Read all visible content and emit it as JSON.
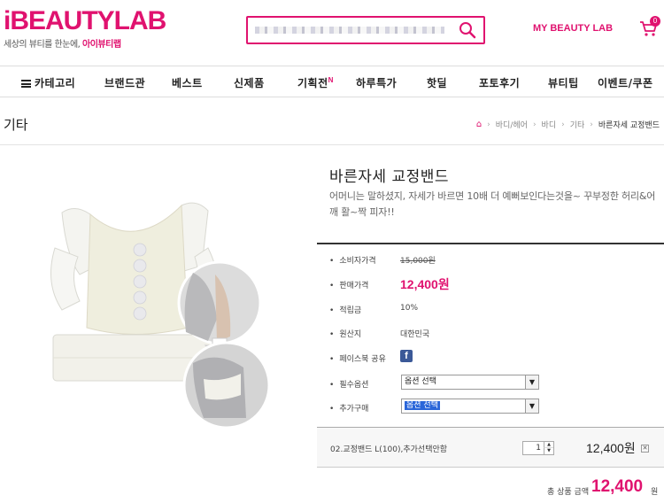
{
  "header": {
    "logo": "iBEAUTYLAB",
    "tagline_prefix": "세상의 뷰티를 한눈에,",
    "tagline_brand": "아이뷰티랩",
    "search_placeholder": "",
    "my_beauty_lab": "MY BEAUTY LAB",
    "cart_count": "0"
  },
  "nav": {
    "category": "카테고리",
    "items": [
      "브랜드관",
      "베스트",
      "신제품",
      "기획전",
      "하루특가",
      "핫딜",
      "포토후기",
      "뷰티팁",
      "이벤트/쿠폰"
    ],
    "new_badge": "N"
  },
  "page": {
    "title": "기타",
    "breadcrumb": [
      "바디/헤어",
      "바디",
      "기타",
      "바른자세 교정밴드"
    ]
  },
  "product": {
    "name": "바른자세 교정밴드",
    "description": "어머니는 말하셨지, 자세가 바르면 10배 더 예뻐보인다는것을~ 꾸부정한 허리&어깨 활~짝 피자!!",
    "rows": {
      "consumer_price_label": "소비자가격",
      "consumer_price": "15,000원",
      "sale_price_label": "판매가격",
      "sale_price": "12,400원",
      "points_label": "적립금",
      "points": "10%",
      "origin_label": "원산지",
      "origin": "대한민국",
      "facebook_label": "페이스북 공유",
      "required_label": "필수옵션",
      "required_value": "옵션 선택",
      "additional_label": "추가구매",
      "additional_value": "옵션 선택"
    },
    "selected_option": {
      "name": "02.교정밴드 L(100),추가선택안함",
      "quantity": "1",
      "price": "12,400원"
    },
    "total": {
      "label": "총 상품 금액",
      "price": "12,400",
      "unit": "원"
    }
  },
  "colors": {
    "brand": "#e0126f",
    "facebook": "#3b5998",
    "highlight": "#2a66d9"
  }
}
